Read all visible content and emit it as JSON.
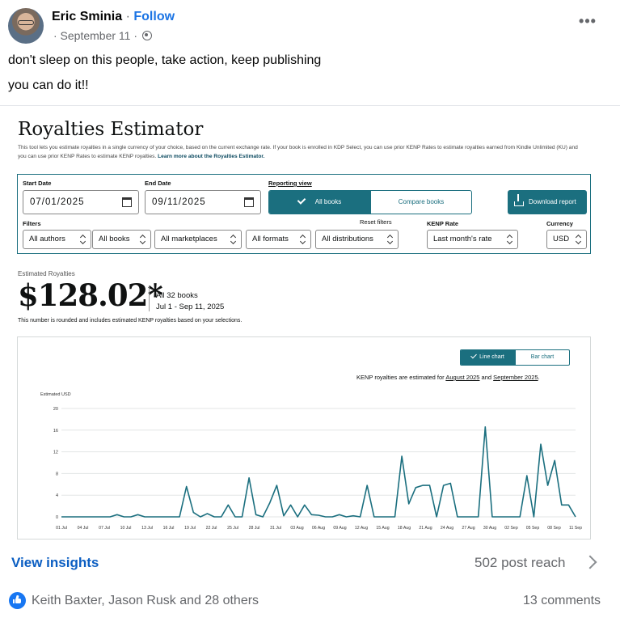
{
  "post": {
    "author": "Eric Sminia",
    "separator": " · ",
    "follow": "Follow",
    "date": "· September 11 ·",
    "line1": "don't sleep on this people, take action, keep publishing",
    "line2": "you can do it!!"
  },
  "estimator": {
    "title": "Royalties Estimator",
    "description": "This tool lets you estimate royalties in a single currency of your choice, based on the current exchange rate. If your book is enrolled in KDP Select, you can use prior KENP Rates to estimate royalties earned from Kindle Unlimited (KU) and you can use prior KENP Rates to estimate KENP royalties.",
    "learn_more": "Learn more about the Royalties Estimator.",
    "start_label": "Start Date",
    "start_value": "07/01/2025",
    "end_label": "End Date",
    "end_value": "09/11/2025",
    "reporting_label": "Reporting view",
    "all_books": "All books",
    "compare_books": "Compare books",
    "download": "Download report",
    "filters_label": "Filters",
    "reset_filters": "Reset filters",
    "kenp_label": "KENP Rate",
    "currency_label": "Currency",
    "filters": [
      "All authors",
      "All books",
      "All marketplaces",
      "All formats",
      "All distributions"
    ],
    "kenp_value": "Last month's rate",
    "currency_value": "USD",
    "est_label": "Estimated Royalties",
    "est_value": "$128.02*",
    "books": "All 32 books",
    "range": "Jul 1 - Sep 11, 2025",
    "note": "This number is rounded and includes estimated KENP royalties based on your selections."
  },
  "chart_panel": {
    "line_chart": "Line chart",
    "bar_chart": "Bar chart",
    "kenp_prefix": "KENP royalties are estimated for ",
    "kenp_month1": "August 2025",
    "kenp_and": " and ",
    "kenp_month2": "September 2025",
    "kenp_end": "."
  },
  "chart_data": {
    "type": "line",
    "ylabel": "Estimated USD",
    "ylim": [
      0,
      20
    ],
    "yticks": [
      0,
      4,
      8,
      12,
      16,
      20
    ],
    "x_tick_labels": [
      "01 Jul",
      "04 Jul",
      "07 Jul",
      "10 Jul",
      "13 Jul",
      "16 Jul",
      "19 Jul",
      "22 Jul",
      "25 Jul",
      "28 Jul",
      "31 Jul",
      "03 Aug",
      "06 Aug",
      "09 Aug",
      "12 Aug",
      "15 Aug",
      "18 Aug",
      "21 Aug",
      "24 Aug",
      "27 Aug",
      "30 Aug",
      "02 Sep",
      "05 Sep",
      "08 Sep",
      "11 Sep"
    ],
    "values": [
      0,
      0,
      0,
      0,
      0,
      0,
      0,
      0,
      0.4,
      0,
      0,
      0.4,
      0,
      0,
      0,
      0,
      0,
      0,
      5.6,
      0.8,
      0,
      0.6,
      0,
      0,
      2.2,
      0,
      0,
      7.2,
      0.4,
      0,
      2.6,
      5.8,
      0.2,
      2.2,
      0,
      2.2,
      0.4,
      0.3,
      0,
      0,
      0.4,
      0,
      0.2,
      0,
      5.8,
      0,
      0,
      0,
      0,
      11.2,
      2.4,
      5.4,
      5.8,
      5.8,
      0,
      5.8,
      6.2,
      0,
      0,
      0,
      0,
      16.6,
      0,
      0,
      0,
      0,
      0,
      7.6,
      0,
      13.4,
      5.8,
      10.4,
      2.2,
      2.2,
      0
    ],
    "color": "#1b6f7f"
  },
  "footer": {
    "view_insights": "View insights",
    "reach": "502 post reach",
    "reactors": "Keith Baxter, Jason Rusk and 28 others",
    "comments": "13 comments"
  }
}
